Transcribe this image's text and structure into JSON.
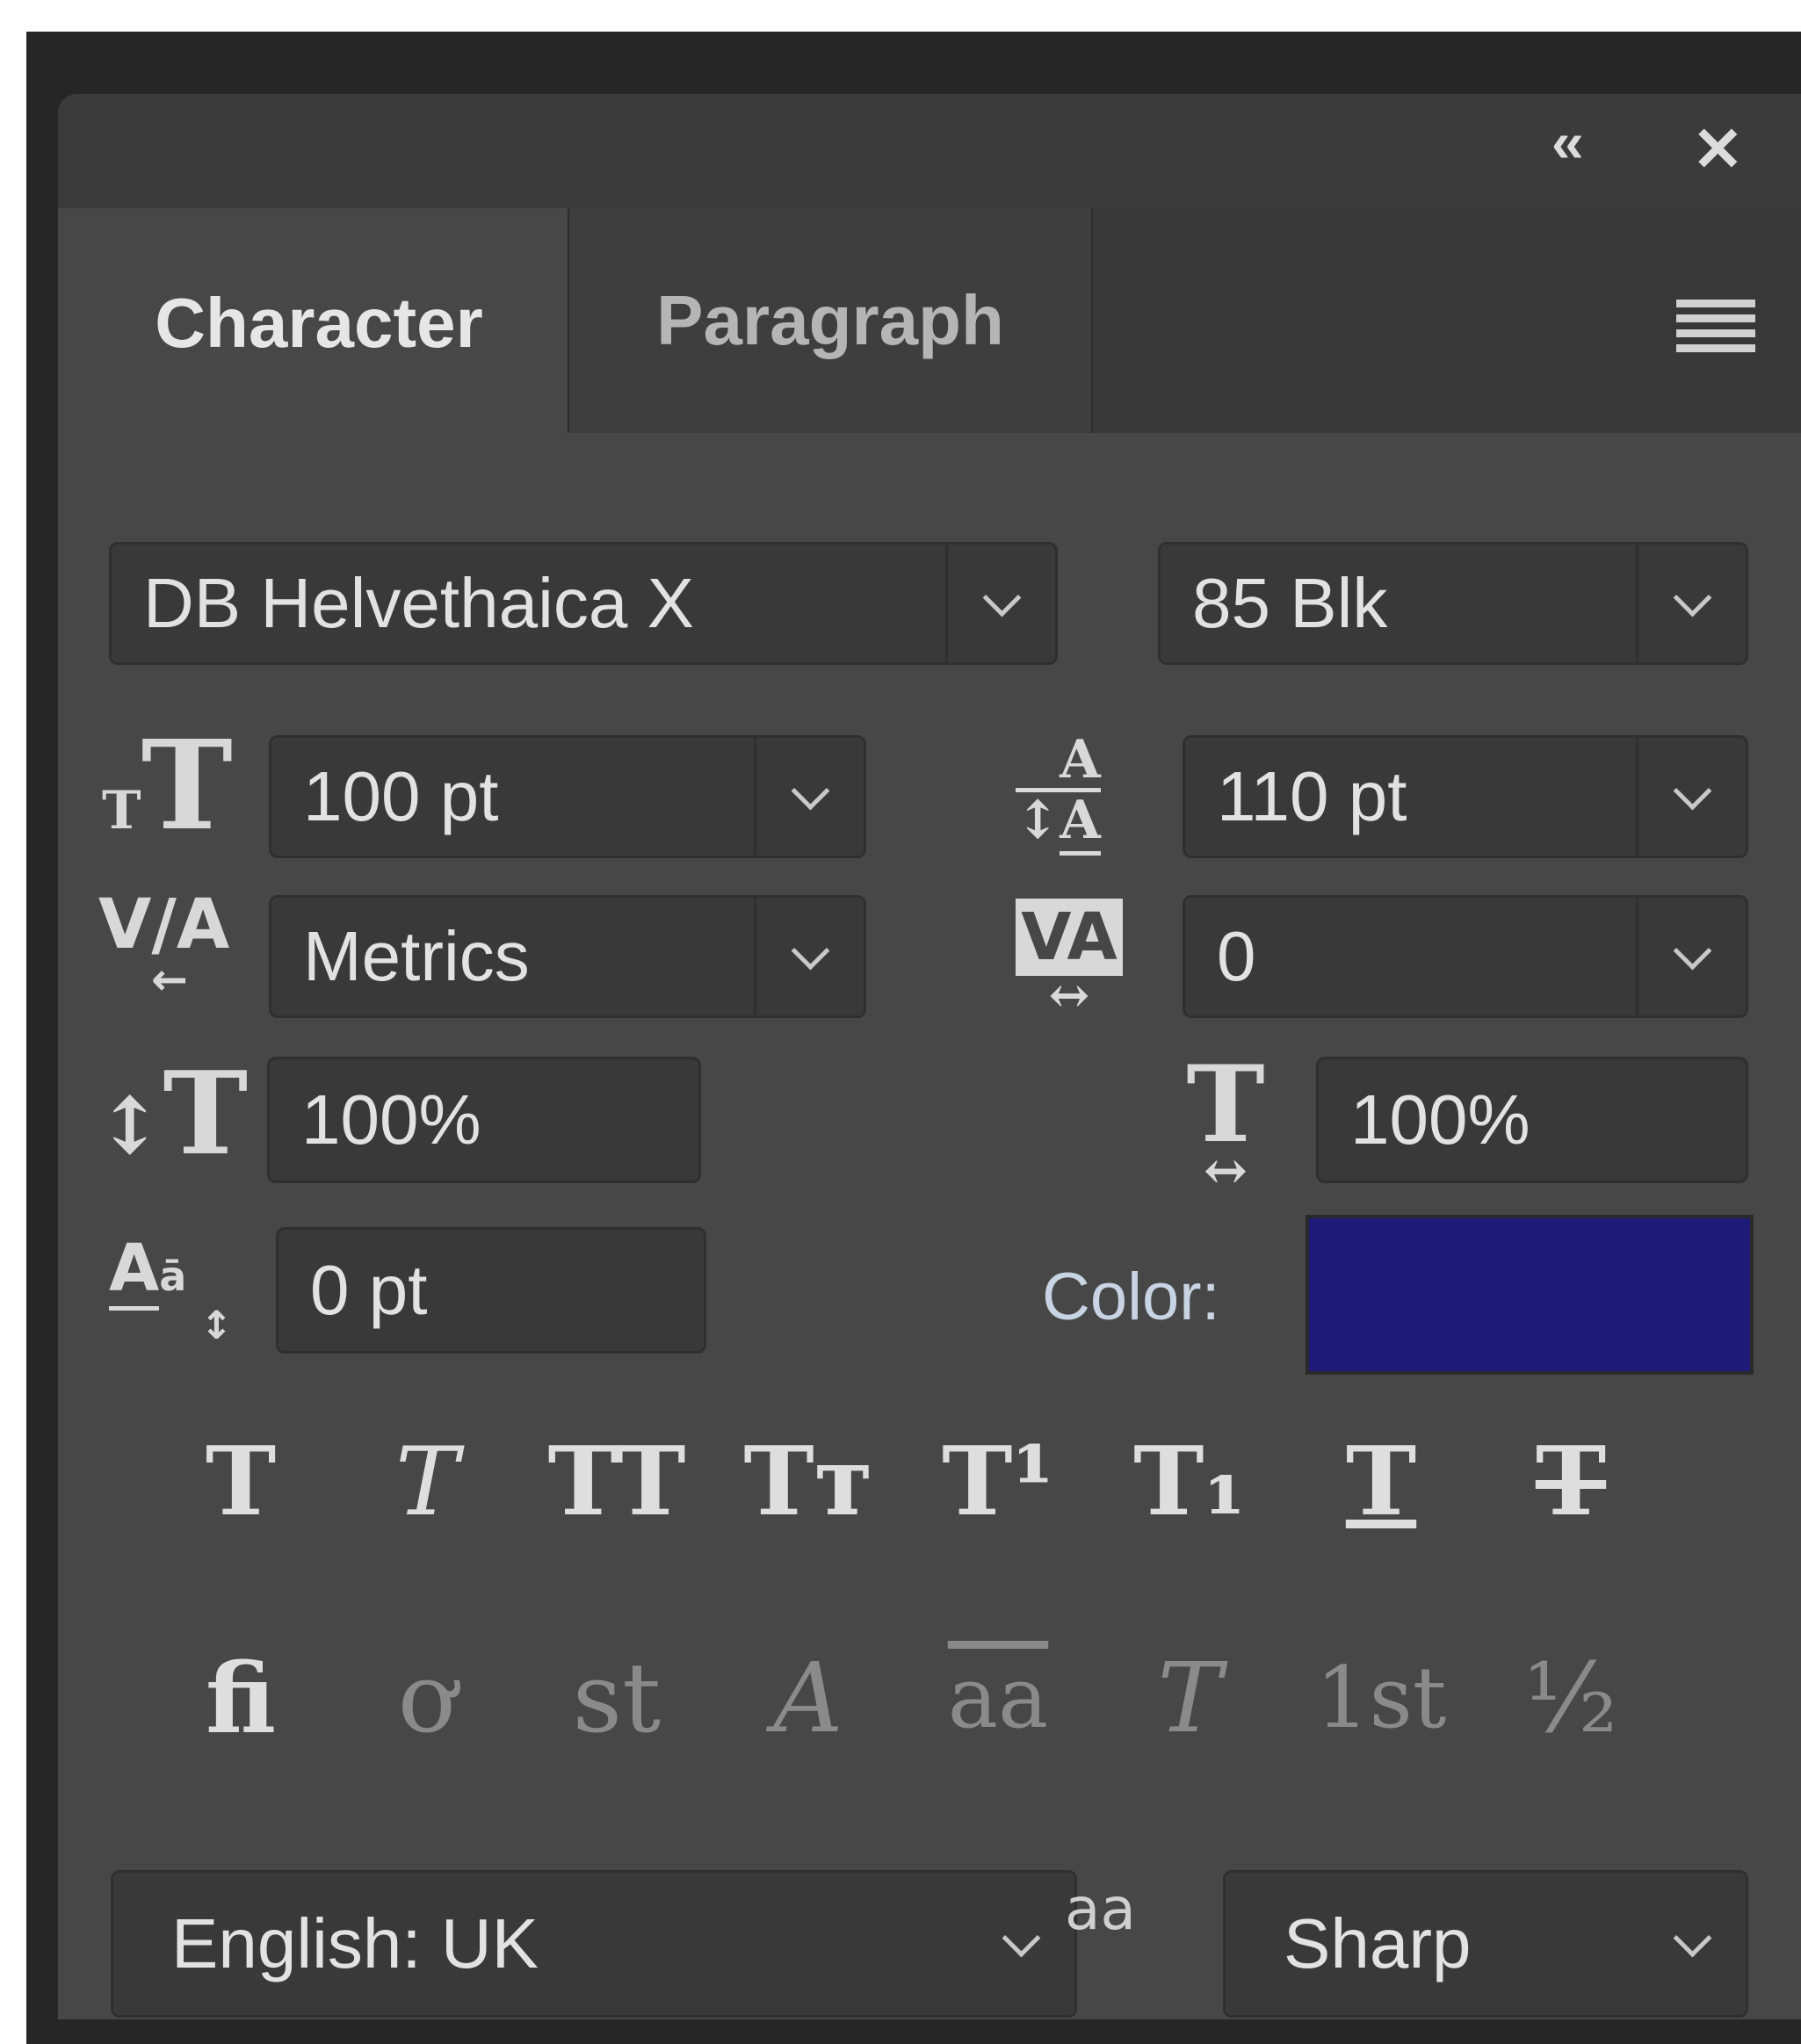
{
  "panel": {
    "tabs": [
      {
        "label": "Character",
        "active": true
      },
      {
        "label": "Paragraph",
        "active": false
      }
    ],
    "titlebar": {
      "collapse_icon": "double-chevron-left-icon",
      "close_icon": "close-icon"
    },
    "menu_icon": "hamburger-menu-icon"
  },
  "font": {
    "family": "DB Helvethaica X",
    "style": "85 Blk"
  },
  "metrics": {
    "size": "100 pt",
    "leading": "110 pt",
    "kerning": "Metrics",
    "tracking": "0",
    "vertical_scale": "100%",
    "horizontal_scale": "100%",
    "baseline_shift": "0 pt"
  },
  "color": {
    "label": "Color:",
    "value": "#1f1a78"
  },
  "style_buttons": [
    {
      "name": "faux-bold",
      "glyph": "T"
    },
    {
      "name": "faux-italic",
      "glyph": "T"
    },
    {
      "name": "all-caps",
      "glyph": "TT"
    },
    {
      "name": "small-caps",
      "glyph": "Tт"
    },
    {
      "name": "superscript",
      "glyph": "T¹"
    },
    {
      "name": "subscript",
      "glyph": "T₁"
    },
    {
      "name": "underline",
      "glyph": "T"
    },
    {
      "name": "strikethrough",
      "glyph": "T"
    }
  ],
  "opentype_buttons": [
    {
      "name": "standard-ligatures",
      "glyph": "ﬁ"
    },
    {
      "name": "contextual-alternates",
      "glyph": "ơ"
    },
    {
      "name": "discretionary-ligatures",
      "glyph": "st"
    },
    {
      "name": "swash",
      "glyph": "A"
    },
    {
      "name": "stylistic-alternates",
      "glyph": "aa"
    },
    {
      "name": "titling-alternates",
      "glyph": "T"
    },
    {
      "name": "ordinals",
      "glyph": "1st"
    },
    {
      "name": "fractions",
      "glyph": "½"
    }
  ],
  "language": "English: UK",
  "antialias": "Sharp",
  "antialias_icon_text": "aa"
}
